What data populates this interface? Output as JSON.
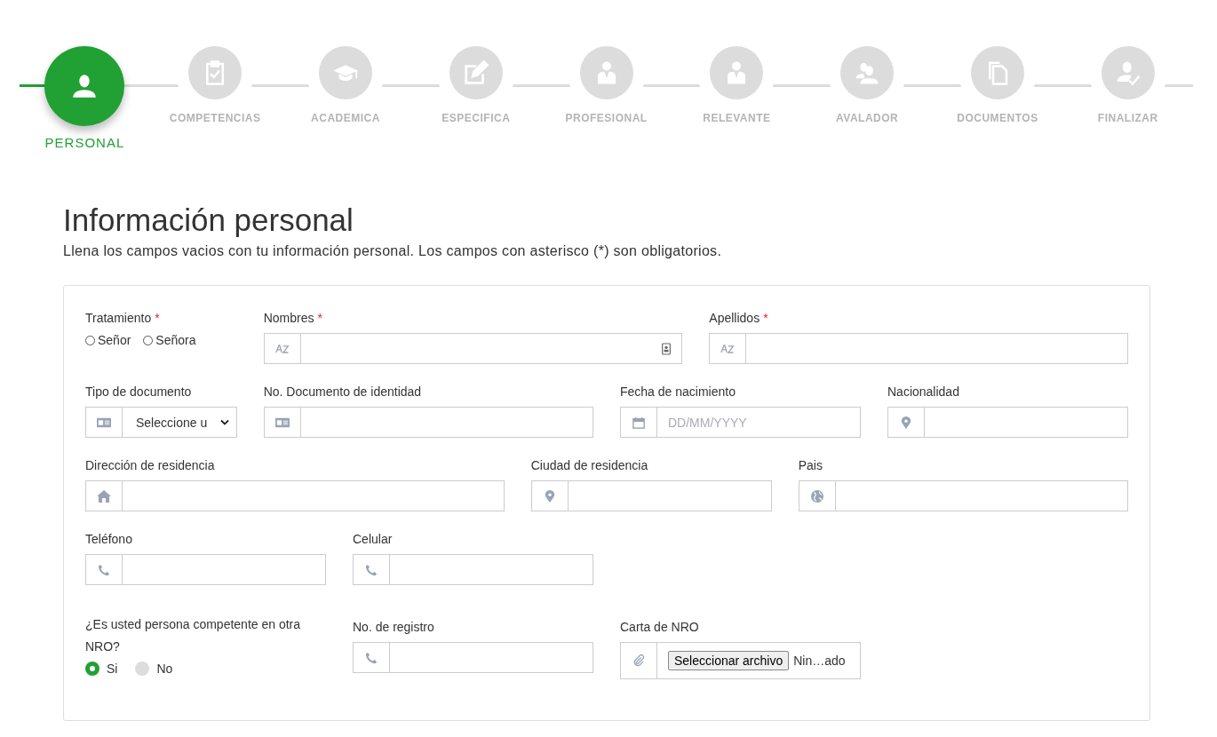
{
  "steps": [
    {
      "label": "PERSONAL",
      "selected": true
    },
    {
      "label": "COMPETENCIAS",
      "selected": false
    },
    {
      "label": "ACADEMICA",
      "selected": false
    },
    {
      "label": "ESPECIFICA",
      "selected": false
    },
    {
      "label": "PROFESIONAL",
      "selected": false
    },
    {
      "label": "RELEVANTE",
      "selected": false
    },
    {
      "label": "AVALADOR",
      "selected": false
    },
    {
      "label": "DOCUMENTOS",
      "selected": false
    },
    {
      "label": "FINALIZAR",
      "selected": false
    }
  ],
  "heading": "Información personal",
  "intro": "Llena los campos vacios con tu información personal. Los campos con asterisco (*) son obligatorios.",
  "fields": [
    {
      "kind": "radio",
      "label": "Tratamiento",
      "mark": "*",
      "options": [
        {
          "label": "Señor",
          "selected": false
        },
        {
          "label": "Señora",
          "selected": false
        }
      ]
    },
    {
      "kind": "text",
      "label": "Nombres",
      "mark": "*"
    },
    {
      "kind": "text",
      "label": "Apellidos",
      "mark": "*"
    },
    {
      "kind": "select",
      "label": "Tipo de documento",
      "value": "Seleccione u"
    },
    {
      "kind": "text",
      "label": "No. Documento de identidad"
    },
    {
      "kind": "text",
      "label": "Fecha de nacimiento",
      "placeholder": "DD/MM/YYYY"
    },
    {
      "kind": "text",
      "label": "Nacionalidad"
    },
    {
      "kind": "text",
      "label": "Dirección de residencia"
    },
    {
      "kind": "text",
      "label": "Ciudad de residencia"
    },
    {
      "kind": "text",
      "label": "Pais"
    },
    {
      "kind": "text",
      "label": "Teléfono"
    },
    {
      "kind": "text",
      "label": "Celular"
    },
    {
      "kind": "choice",
      "label": "¿Es usted persona competente en otra NRO?",
      "options": [
        {
          "label": "Si",
          "selected": true
        },
        {
          "label": "No",
          "selected": false
        }
      ]
    },
    {
      "kind": "text",
      "label": "No. de registro"
    },
    {
      "kind": "file",
      "label": "Carta de NRO",
      "button": "Seleccionar archivo",
      "status": "Nin…ado"
    }
  ]
}
